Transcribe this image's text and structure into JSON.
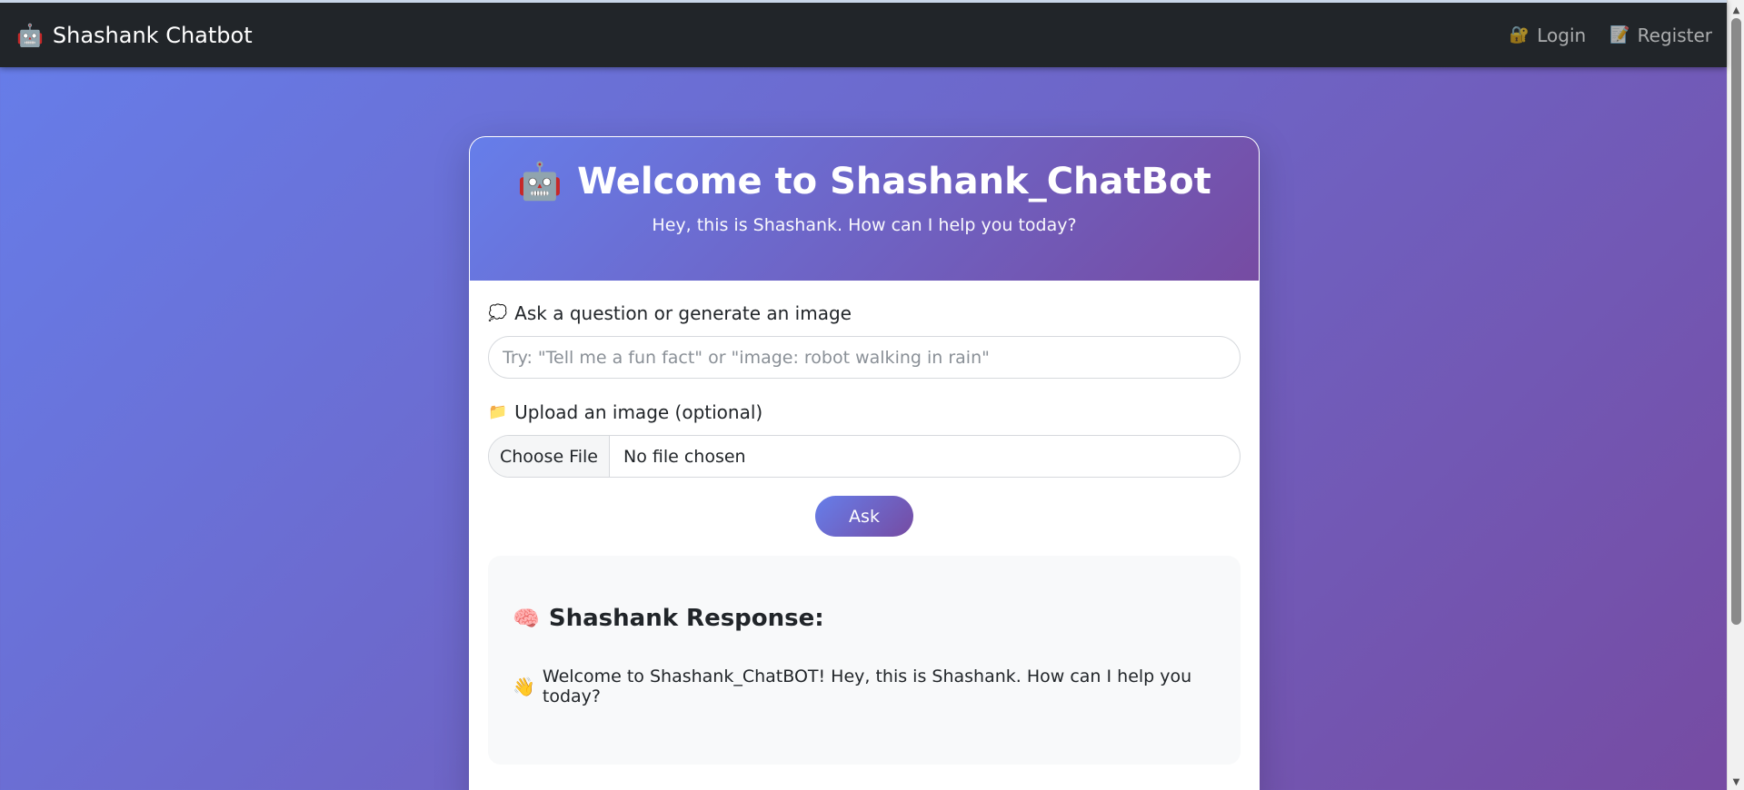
{
  "navbar": {
    "brand_icon": "🤖",
    "brand_label": "Shashank Chatbot",
    "login_icon": "🔐",
    "login_label": "Login",
    "register_icon": "📝",
    "register_label": "Register"
  },
  "card": {
    "title_icon": "🤖",
    "title": "Welcome to Shashank_ChatBot",
    "subtitle": "Hey, this is Shashank. How can I help you today?"
  },
  "form": {
    "question_icon": "💭",
    "question_label": "Ask a question or generate an image",
    "question_placeholder": "Try: \"Tell me a fun fact\" or \"image: robot walking in rain\"",
    "upload_icon": "📁",
    "upload_label": "Upload an image (optional)",
    "choose_file_label": "Choose File",
    "file_status": "No file chosen",
    "ask_label": "Ask"
  },
  "response": {
    "title_icon": "🧠",
    "title": "Shashank Response:",
    "message_icon": "👋",
    "message": "Welcome to Shashank_ChatBOT! Hey, this is Shashank. How can I help you today?"
  },
  "colors": {
    "gradient_start": "#667eea",
    "gradient_end": "#764ba2",
    "navbar_bg": "#212529",
    "response_bg": "#f8f9fa"
  }
}
